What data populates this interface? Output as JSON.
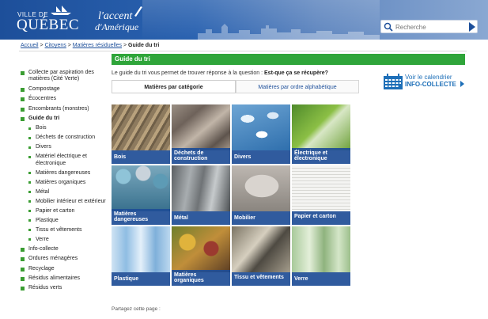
{
  "header": {
    "logo_small": "VILLE DE",
    "logo_big": "QUÉBEC",
    "tagline_1": "l'accent",
    "tagline_2": "d'Amérique",
    "search_placeholder": "Recherche"
  },
  "breadcrumb": {
    "home": "Accueil",
    "sep1": " > ",
    "citizens": "Citoyens",
    "sep2": " > ",
    "residual": "Matières résiduelles",
    "sep3": " > ",
    "current": "Guide du tri"
  },
  "sidebar": {
    "items": [
      {
        "label": "Collecte par aspiration des matières (Cité Verte)"
      },
      {
        "label": "Compostage"
      },
      {
        "label": "Écocentres"
      },
      {
        "label": "Encombrants (monstres)"
      },
      {
        "label": "Guide du tri"
      },
      {
        "label": "Info-collecte"
      },
      {
        "label": "Ordures ménagères"
      },
      {
        "label": "Recyclage"
      },
      {
        "label": "Résidus alimentaires"
      },
      {
        "label": "Résidus verts"
      }
    ],
    "subitems": [
      {
        "label": "Bois"
      },
      {
        "label": "Déchets de construction"
      },
      {
        "label": "Divers"
      },
      {
        "label": "Matériel électrique et électronique"
      },
      {
        "label": "Matières dangereuses"
      },
      {
        "label": "Matières organiques"
      },
      {
        "label": "Métal"
      },
      {
        "label": "Mobilier intérieur et extérieur"
      },
      {
        "label": "Papier et carton"
      },
      {
        "label": "Plastique"
      },
      {
        "label": "Tissu et vêtements"
      },
      {
        "label": "Verre"
      }
    ]
  },
  "main": {
    "title": "Guide du tri",
    "intro_text": "Le guide du tri vous permet de trouver réponse à la question : ",
    "intro_bold": "Est-que ça se récupère?",
    "tab_category": "Matières par catégorie",
    "tab_alpha": "Matières par ordre alphabétique",
    "calendar_line1": "Voir le calendrier",
    "calendar_line2": "INFO-COLLECTE"
  },
  "tiles": [
    {
      "label": "Bois"
    },
    {
      "label": "Déchets de construction"
    },
    {
      "label": "Divers"
    },
    {
      "label": "Électrique et électronique"
    },
    {
      "label": "Matières dangereuses"
    },
    {
      "label": "Métal"
    },
    {
      "label": "Mobilier"
    },
    {
      "label": "Papier et carton"
    },
    {
      "label": "Plastique"
    },
    {
      "label": "Matières organiques"
    },
    {
      "label": "Tissu et vêtements"
    },
    {
      "label": "Verre"
    }
  ],
  "share": {
    "label": "Partagez cette page :"
  },
  "colors": {
    "brand_blue": "#1d4f9a",
    "green": "#2fa53a",
    "tile_label_bg": "#1e4d96"
  }
}
